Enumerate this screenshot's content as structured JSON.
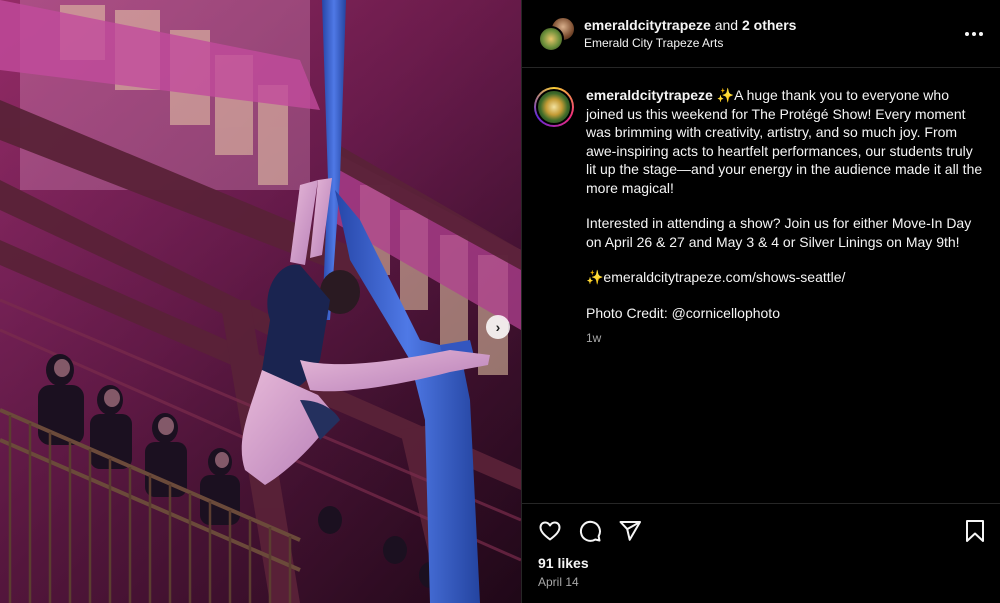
{
  "header": {
    "username": "emeraldcitytrapeze",
    "and_text": "and",
    "others_text": "2 others",
    "subtitle": "Emerald City Trapeze Arts"
  },
  "caption": {
    "username": "emeraldcitytrapeze",
    "paragraph1": "✨A huge thank you to everyone who joined us this weekend for The Protégé Show! Every moment was brimming with creativity, artistry, and so much joy. From awe-inspiring acts to heartfelt performances, our students truly lit up the stage—and your energy in the audience made it all the more magical!",
    "paragraph2": "Interested in attending a show? Join us for either Move-In Day on April 26 & 27 and May 3 & 4 or Silver Linings on May 9th!",
    "paragraph3": "✨emeraldcitytrapeze.com/shows-seattle/",
    "paragraph4": "Photo Credit: @cornicellophoto",
    "time_ago": "1w"
  },
  "footer": {
    "likes": "91 likes",
    "date": "April 14"
  },
  "icons": {
    "like": "heart-icon",
    "comment": "comment-icon",
    "share": "share-icon",
    "save": "bookmark-icon",
    "more": "more-icon",
    "next": "chevron-right-icon"
  },
  "colors": {
    "background": "#000000",
    "text": "#f5f5f5",
    "muted": "#a8a8a8",
    "divider": "#262626",
    "silk": "#3a5fd0"
  }
}
